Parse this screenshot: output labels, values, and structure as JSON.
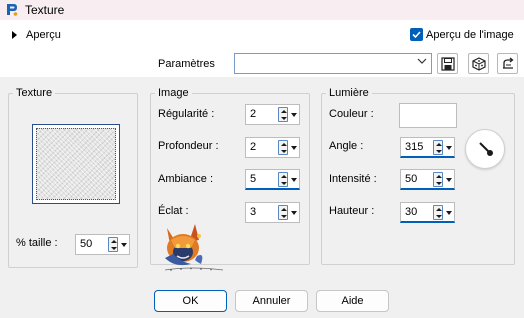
{
  "window": {
    "title": "Texture"
  },
  "preview": {
    "toggle_label": "Aperçu",
    "checkbox_label": "Aperçu de l'image",
    "checkbox_checked": true
  },
  "params": {
    "label": "Paramètres",
    "value": "",
    "buttons": [
      "save-icon",
      "random-icon",
      "reset-icon"
    ]
  },
  "texture": {
    "title": "Texture",
    "size_label": "% taille :",
    "size_value": "50"
  },
  "image": {
    "title": "Image",
    "fields": [
      {
        "label": "Régularité :",
        "value": "2"
      },
      {
        "label": "Profondeur :",
        "value": "2"
      },
      {
        "label": "Ambiance :",
        "value": "5"
      },
      {
        "label": "Éclat :",
        "value": "3"
      }
    ]
  },
  "lumiere": {
    "title": "Lumière",
    "color_label": "Couleur :",
    "color_value": "#ffffff",
    "fields": [
      {
        "label": "Angle :",
        "value": "315"
      },
      {
        "label": "Intensité :",
        "value": "50"
      },
      {
        "label": "Hauteur :",
        "value": "30"
      }
    ]
  },
  "watermark": {
    "text": "Violette's Graph"
  },
  "buttons": {
    "ok": "OK",
    "cancel": "Annuler",
    "help": "Aide"
  },
  "colors": {
    "accent": "#005fb8",
    "titlebar": "#f8eef1",
    "dialog_bg": "#f0f0f0"
  }
}
